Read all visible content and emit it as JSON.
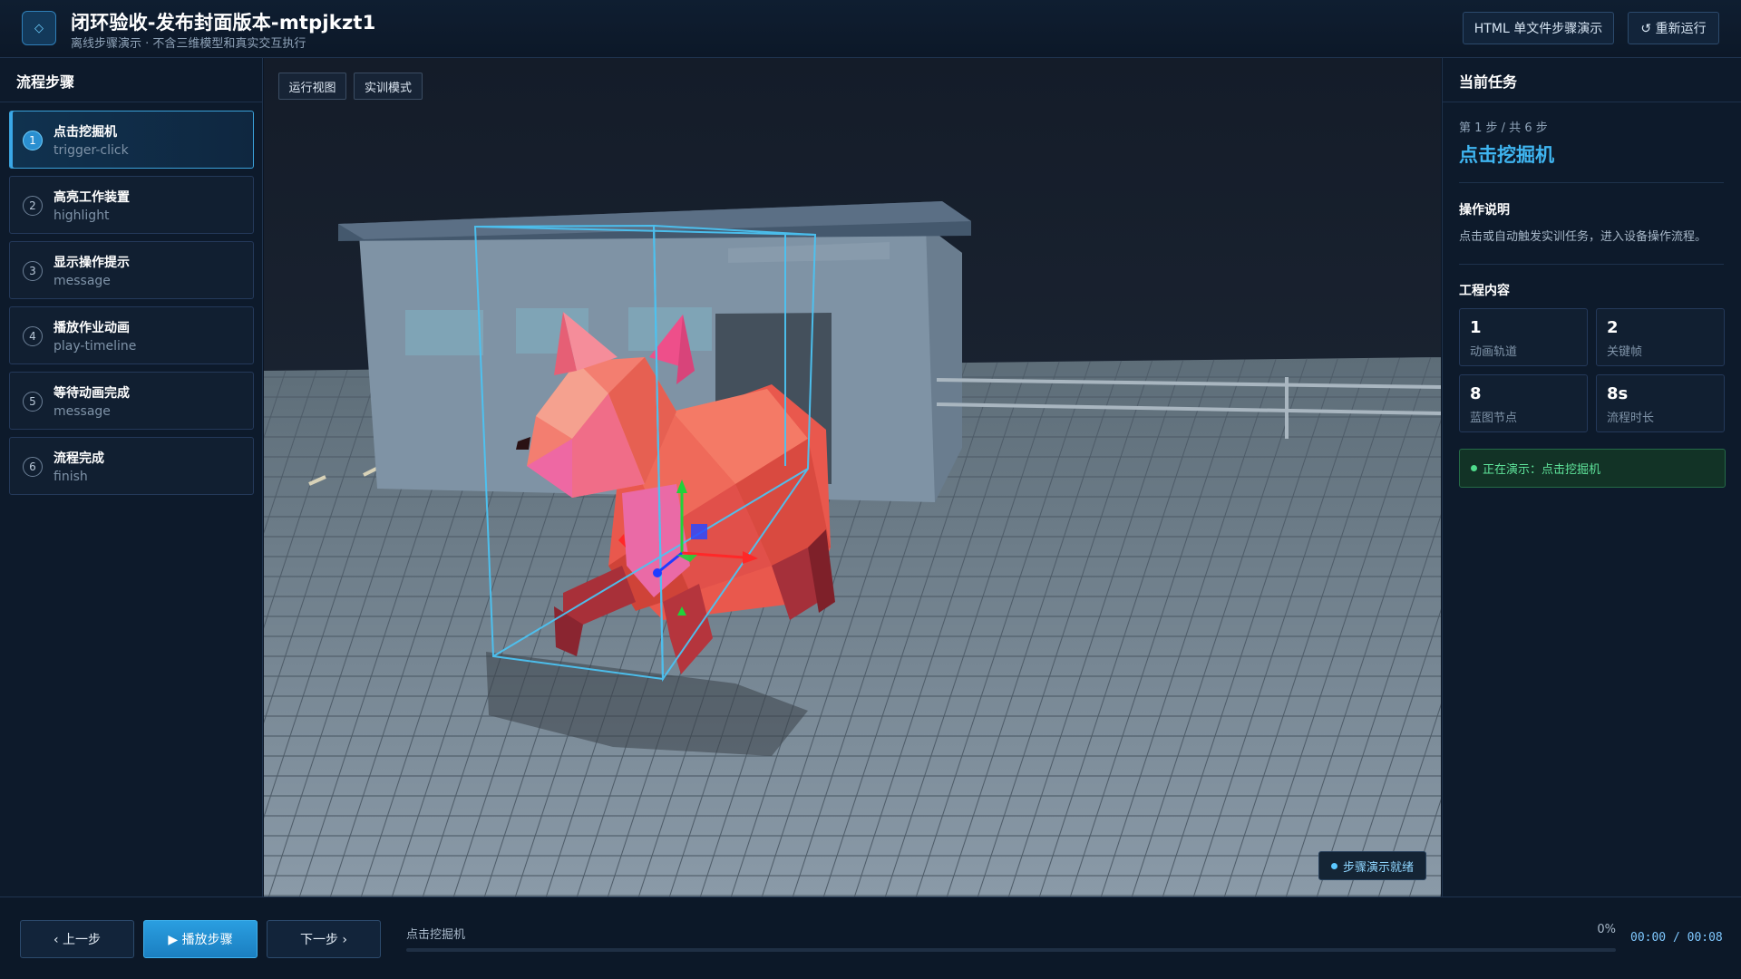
{
  "header": {
    "title": "闭环验收-发布封面版本-mtpjkzt1",
    "subtitle": "离线步骤演示 · 不含三维模型和真实交互执行",
    "logo_icon": "diamond-icon",
    "html_demo_label": "HTML 单文件步骤演示",
    "rerun_label": "↺ 重新运行"
  },
  "sidebar": {
    "title": "流程步骤",
    "steps": [
      {
        "num": "1",
        "name": "点击挖掘机",
        "code": "trigger-click",
        "active": true
      },
      {
        "num": "2",
        "name": "高亮工作装置",
        "code": "highlight",
        "active": false
      },
      {
        "num": "3",
        "name": "显示操作提示",
        "code": "message",
        "active": false
      },
      {
        "num": "4",
        "name": "播放作业动画",
        "code": "play-timeline",
        "active": false
      },
      {
        "num": "5",
        "name": "等待动画完成",
        "code": "message",
        "active": false
      },
      {
        "num": "6",
        "name": "流程完成",
        "code": "finish",
        "active": false
      }
    ]
  },
  "viewport": {
    "run_view_label": "运行视图",
    "training_mode_label": "实训模式",
    "status_chip": "步骤演示就绪"
  },
  "task_panel": {
    "title": "当前任务",
    "progress": "第 1 步 / 共 6 步",
    "task_name": "点击挖掘机",
    "instructions_title": "操作说明",
    "instructions": "点击或自动触发实训任务，进入设备操作流程。",
    "project_title": "工程内容",
    "stats": [
      {
        "value": "1",
        "label": "动画轨道"
      },
      {
        "value": "2",
        "label": "关键帧"
      },
      {
        "value": "8",
        "label": "蓝图节点"
      },
      {
        "value": "8s",
        "label": "流程时长"
      }
    ],
    "demo_status": "正在演示：点击挖掘机"
  },
  "bottom": {
    "prev_label": "‹ 上一步",
    "play_label": "▶ 播放步骤",
    "next_label": "下一步 ›",
    "current_step": "点击挖掘机",
    "progress_percent": "0%",
    "progress_value": 0,
    "time": "00:00 / 00:08"
  },
  "colors": {
    "accent": "#3fb5f0",
    "success": "#5ee39a",
    "background": "#0b1524"
  }
}
